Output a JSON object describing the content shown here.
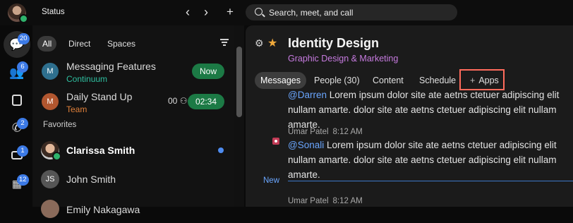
{
  "topbar": {
    "status_label": "Status",
    "back_icon": "chevron-left-icon",
    "forward_icon": "chevron-right-icon",
    "new_icon": "plus-icon",
    "search_placeholder": "Search, meet, and call"
  },
  "rail": {
    "items": [
      {
        "icon": "chat-icon",
        "badge": "20"
      },
      {
        "icon": "teams-icon",
        "badge": "6"
      },
      {
        "icon": "contacts-icon",
        "badge": ""
      },
      {
        "icon": "phone-icon",
        "badge": "2"
      },
      {
        "icon": "meetings-icon",
        "badge": "1"
      },
      {
        "icon": "calendar-icon",
        "badge": "12"
      }
    ]
  },
  "list": {
    "filters": [
      "All",
      "Direct",
      "Spaces"
    ],
    "conversations": [
      {
        "initial": "M",
        "title": "Messaging Features",
        "subtitle": "Continuum",
        "subtitle_color": "#2fbfa0",
        "pill": "Now",
        "avatar_color": "#2e6f8e"
      },
      {
        "initial": "M",
        "title": "Daily Stand Up",
        "subtitle": "Team",
        "subtitle_color": "#e0803a",
        "pill": "02:34",
        "participants": "00",
        "avatar_color": "#b1562f"
      }
    ],
    "favorites_label": "Favorites",
    "favorites": [
      {
        "initials": "",
        "name": "Clarissa Smith",
        "unread": true
      },
      {
        "initials": "JS",
        "name": "John Smith",
        "unread": false
      },
      {
        "initials": "",
        "name": "Emily Nakagawa",
        "unread": false
      }
    ]
  },
  "main": {
    "title": "Identity Design",
    "subtitle": "Graphic Design & Marketing",
    "tabs": [
      "Messages",
      "People (30)",
      "Content",
      "Schedule"
    ],
    "apps_tab": "Apps",
    "messages": [
      {
        "mention": "@Darren",
        "text": " Lorem ipsum dolor site ate aetns ctetuer adipiscing elit nullam amarte. dolor site ate aetns ctetuer adipiscing elit nullam amarte."
      },
      {
        "author": "Umar Patel",
        "time": "8:12 AM",
        "mention": "@Sonali",
        "text": " Lorem ipsum dolor site ate aetns ctetuer adipiscing elit nullam amarte. dolor site ate aetns ctetuer adipiscing elit nullam amarte."
      },
      {
        "author": "Umar Patel",
        "time": "8:12 AM"
      }
    ],
    "new_label": "New"
  },
  "colors": {
    "accent_blue": "#3c7ae6",
    "online_green": "#2fb36c",
    "pill_green": "#1c7a45",
    "star": "#f0a93b",
    "highlight_box": "#ff6b5c",
    "space_subtitle": "#c77be0"
  }
}
